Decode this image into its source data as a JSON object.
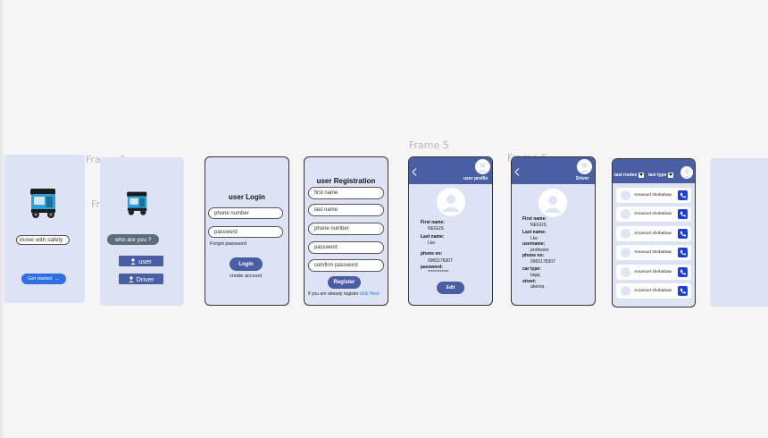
{
  "labels": {
    "frame2": "Frame 2",
    "frame1": "Frame 1",
    "frame5": "Frame 5",
    "frame6": "Frame 6"
  },
  "splash": {
    "tagline": "move with safety",
    "cta": "Get started",
    "arrow": "→"
  },
  "role": {
    "question": "who are you ?",
    "user": "user",
    "driver": "Driver"
  },
  "login": {
    "title": "user Login",
    "phone_placeholder": "phone number",
    "password_placeholder": "password",
    "forgot": "Forget password",
    "button": "Login",
    "create": "create account"
  },
  "registration": {
    "title": "user  Registration",
    "first": "first name",
    "last": "last name",
    "phone": "phone number",
    "password": "password",
    "confirm": "comfirm password",
    "button": "Register",
    "already": "if you are already register",
    "click": "click Here"
  },
  "profile": {
    "header": "user profile",
    "first_label": "First name:",
    "first_value": "NEGUS",
    "last_label": "Last name:",
    "last_value": "Lke",
    "phone_label": "phone no:",
    "phone_value": "0965178307",
    "password_label": "password:",
    "password_value": "************",
    "edit": "Edit"
  },
  "driver": {
    "header": "Driver",
    "first_label": "First name:",
    "first_value": "NEGUS",
    "last_label": "Last name:",
    "last_value": "Lke",
    "username_label": "username:",
    "username_value": "professor",
    "phone_label": "phone no:",
    "phone_value": "0965178307",
    "car_label": "car type:",
    "car_value": "bajaj",
    "street_label": "street:",
    "street_value": "abema"
  },
  "taxi": {
    "routes": "taxi routes",
    "type": "taxi type",
    "rows": [
      "Amanuel shebabaw",
      "Amanuel shebabaw",
      "Amanuel shebabaw",
      "Amanuel shebabaw",
      "Amanuel shebabaw",
      "Amanuel shebabaw"
    ]
  },
  "colors": {
    "frame_bg": "#dde2f5",
    "accent": "#4a5fa3",
    "cta_blue": "#2f6fe0",
    "phone_blue": "#1a3fd8"
  },
  "icons": [
    "tuktuk-icon",
    "arrow-right-icon",
    "user-icon",
    "back-chevron-icon",
    "avatar-icon",
    "phone-icon",
    "dropdown-icon"
  ]
}
